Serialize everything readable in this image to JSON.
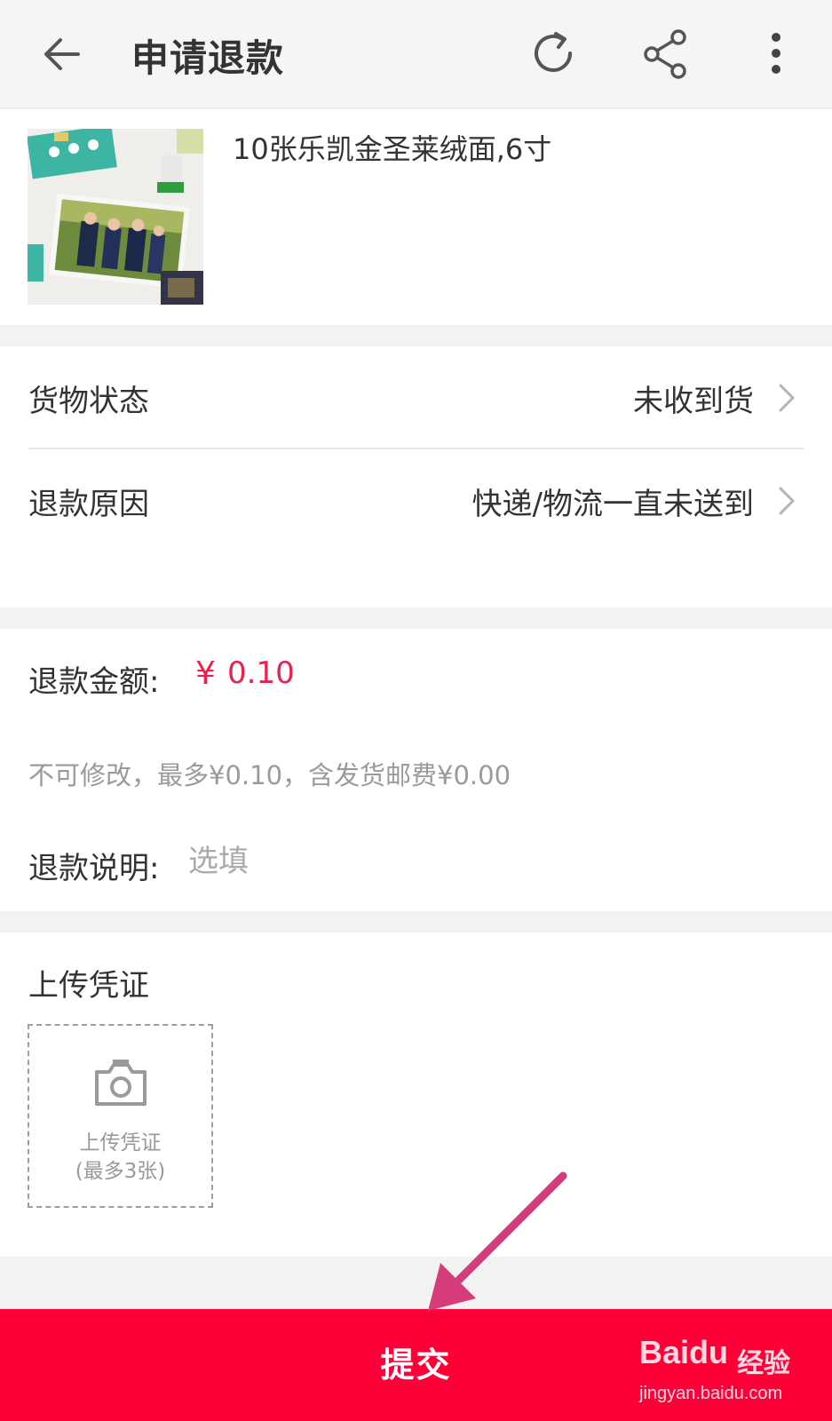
{
  "header": {
    "title": "申请退款",
    "back_icon": "arrow-left-icon",
    "refresh_icon": "refresh-icon",
    "share_icon": "share-icon",
    "more_icon": "more-vertical-icon"
  },
  "product": {
    "name": "10张乐凯金圣莱绒面,6寸",
    "thumbnail": "product-photo-prints-image"
  },
  "goods_status": {
    "label": "货物状态",
    "value": "未收到货"
  },
  "refund_reason": {
    "label": "退款原因",
    "value": "快递/物流一直未送到"
  },
  "refund_amount": {
    "label": "退款金额:",
    "currency_symbol": "¥",
    "amount": "0.10",
    "hint": "不可修改，最多¥0.10，含发货邮费¥0.00"
  },
  "refund_note": {
    "label": "退款说明:",
    "placeholder": "选填"
  },
  "upload": {
    "title": "上传凭证",
    "box_line1": "上传凭证",
    "box_line2": "(最多3张)"
  },
  "submit": {
    "label": "提交"
  },
  "watermark": {
    "logo": "Bai",
    "logo_tail": "du",
    "brand": "经验",
    "url": "jingyan.baidu.com"
  },
  "colors": {
    "accent_red": "#fe0038",
    "price_red": "#e8214e",
    "annotation_arrow": "#d63c7a"
  }
}
